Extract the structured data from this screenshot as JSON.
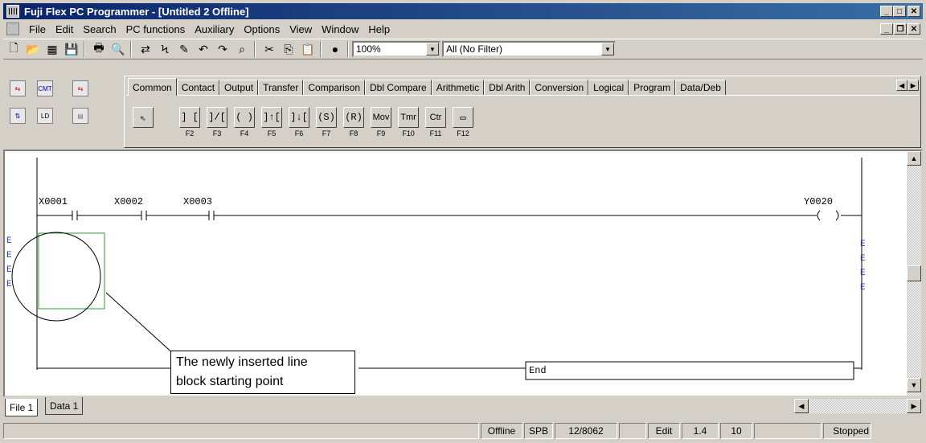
{
  "window": {
    "title": "Fuji Flex PC Programmer - [Untitled 2 Offline]"
  },
  "menu": {
    "items": [
      "File",
      "Edit",
      "Search",
      "PC functions",
      "Auxiliary",
      "Options",
      "View",
      "Window",
      "Help"
    ]
  },
  "toolbar": {
    "zoom": "100%",
    "filter": "All (No Filter)"
  },
  "left_tools": {
    "cmt_label": "CMT\nI/O",
    "ld_label": "LD.\nOR."
  },
  "tabs": [
    "Common",
    "Contact",
    "Output",
    "Transfer",
    "Comparison",
    "Dbl Compare",
    "Arithmetic",
    "Dbl Arith",
    "Conversion",
    "Logical",
    "Program",
    "Data/Deb"
  ],
  "instruction_buttons": [
    {
      "symbol": "] [",
      "key": "F2"
    },
    {
      "symbol": "]/[",
      "key": "F3"
    },
    {
      "symbol": "( )",
      "key": "F4"
    },
    {
      "symbol": "]↑[",
      "key": "F5"
    },
    {
      "symbol": "]↓[",
      "key": "F6"
    },
    {
      "symbol": "(S)",
      "key": "F7"
    },
    {
      "symbol": "(R)",
      "key": "F8"
    },
    {
      "symbol": "Mov",
      "key": "F9"
    },
    {
      "symbol": "Tmr",
      "key": "F10"
    },
    {
      "symbol": "Ctr",
      "key": "F11"
    },
    {
      "symbol": "",
      "key": "F12"
    }
  ],
  "ladder": {
    "contacts": [
      "X0001",
      "X0002",
      "X0003"
    ],
    "coil": "Y0020",
    "error_marks": [
      "E",
      "E",
      "E",
      "E"
    ],
    "end_label": "End"
  },
  "callout": {
    "line1": "The newly inserted line",
    "line2": "block starting point"
  },
  "sheets": [
    "File 1",
    "Data 1"
  ],
  "status": {
    "mode": "Offline",
    "type": "SPB",
    "steps": "12/8062",
    "edit": "Edit",
    "version": "1.4",
    "count": "10",
    "state": "Stopped"
  }
}
